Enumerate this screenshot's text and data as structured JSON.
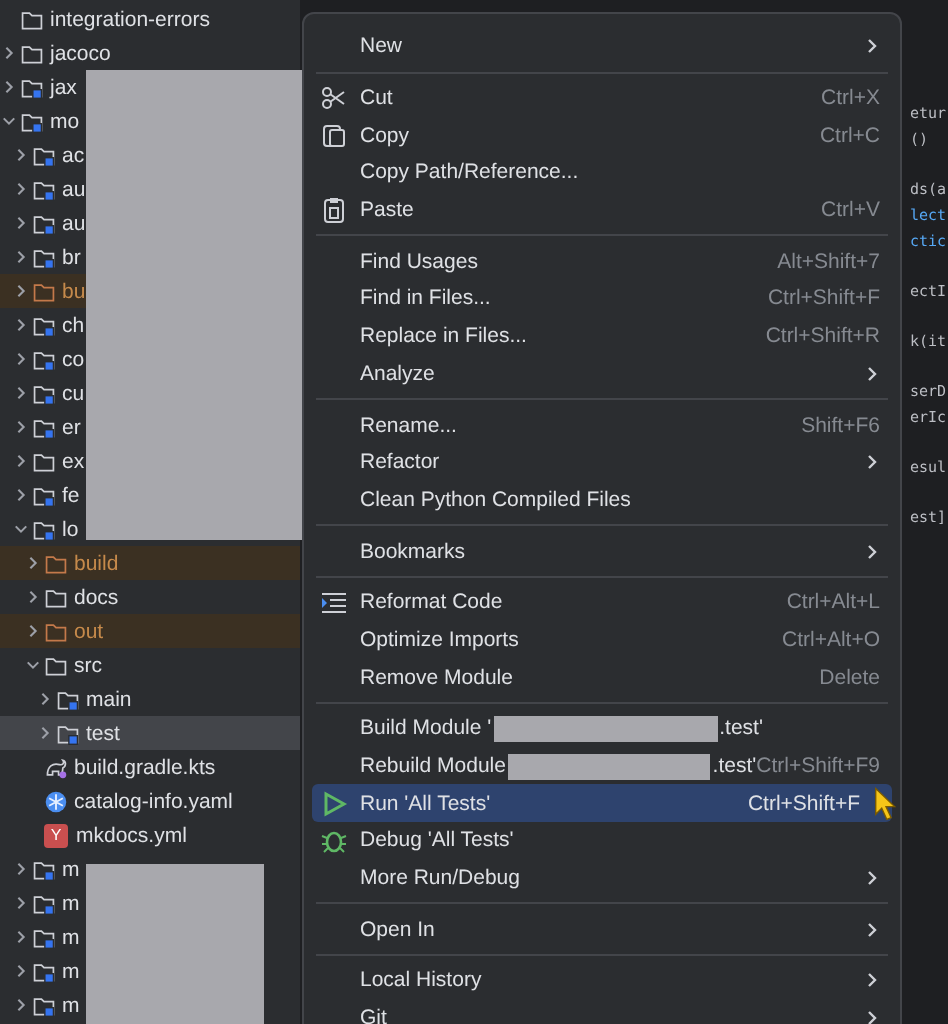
{
  "project_tree": [
    {
      "label": "integration-errors",
      "kind": "folder",
      "selected": false
    },
    {
      "label": "jacoco",
      "kind": "folder",
      "expanded": false,
      "selected": false
    },
    {
      "label": "jax",
      "kind": "module",
      "expanded": false,
      "selected": false
    },
    {
      "label": "mo",
      "kind": "module",
      "expanded": true,
      "selected": false,
      "children": [
        {
          "label": "ac",
          "kind": "module",
          "expanded": false,
          "selected": false
        },
        {
          "label": "au",
          "kind": "module",
          "expanded": false,
          "selected": false
        },
        {
          "label": "au",
          "kind": "module",
          "expanded": false,
          "selected": false
        },
        {
          "label": "br",
          "kind": "module",
          "expanded": false,
          "selected": false
        },
        {
          "label": "bu",
          "kind": "excluded",
          "expanded": false,
          "selected": false
        },
        {
          "label": "ch",
          "kind": "module",
          "expanded": false,
          "selected": false
        },
        {
          "label": "co",
          "kind": "module",
          "expanded": false,
          "selected": false
        },
        {
          "label": "cu",
          "kind": "module",
          "expanded": false,
          "selected": false
        },
        {
          "label": "er",
          "kind": "module",
          "expanded": false,
          "selected": false
        },
        {
          "label": "ex",
          "kind": "folder",
          "expanded": false,
          "selected": false
        },
        {
          "label": "fe",
          "kind": "module",
          "expanded": false,
          "selected": false
        },
        {
          "label": "lo",
          "kind": "module",
          "expanded": true,
          "selected": false,
          "children": [
            {
              "label": "build",
              "kind": "excluded",
              "expanded": false,
              "selected": false
            },
            {
              "label": "docs",
              "kind": "folder",
              "expanded": false,
              "selected": false
            },
            {
              "label": "out",
              "kind": "excluded",
              "expanded": false,
              "selected": false
            },
            {
              "label": "src",
              "kind": "folder",
              "expanded": true,
              "selected": false,
              "children": [
                {
                  "label": "main",
                  "kind": "source",
                  "expanded": false,
                  "selected": false
                },
                {
                  "label": "test",
                  "kind": "source",
                  "expanded": false,
                  "selected": true
                }
              ]
            },
            {
              "label": "build.gradle.kts",
              "kind": "gradle",
              "selected": false
            },
            {
              "label": "catalog-info.yaml",
              "kind": "catalog",
              "selected": false
            },
            {
              "label": "mkdocs.yml",
              "kind": "yaml",
              "icon_text": "Y",
              "selected": false
            }
          ]
        },
        {
          "label": "m",
          "kind": "module",
          "expanded": false,
          "selected": false
        },
        {
          "label": "m",
          "kind": "module",
          "expanded": false,
          "selected": false
        },
        {
          "label": "m",
          "kind": "module",
          "expanded": false,
          "selected": false
        },
        {
          "label": "m",
          "kind": "module",
          "expanded": false,
          "selected": false
        },
        {
          "label": "m",
          "kind": "module",
          "expanded": false,
          "selected": false
        }
      ]
    }
  ],
  "code_fragments": [
    [
      "etur",
      "()"
    ],
    [
      "ds(a",
      "lect",
      "ctic"
    ],
    [
      "ectI"
    ],
    [
      "k(it"
    ],
    [
      "serD",
      "erIc"
    ],
    [
      "esul"
    ],
    [
      "est]"
    ]
  ],
  "context_menu": [
    [
      {
        "label": "New",
        "submenu": true,
        "selected": false
      }
    ],
    [
      {
        "label": "Cut",
        "shortcut": "Ctrl+X",
        "kind": "scissors",
        "selected": false
      },
      {
        "label": "Copy",
        "shortcut": "Ctrl+C",
        "kind": "copy",
        "selected": false
      },
      {
        "label": "Copy Path/Reference...",
        "selected": false
      },
      {
        "label": "Paste",
        "shortcut": "Ctrl+V",
        "kind": "paste",
        "selected": false
      }
    ],
    [
      {
        "label": "Find Usages",
        "shortcut": "Alt+Shift+7",
        "selected": false
      },
      {
        "label": "Find in Files...",
        "shortcut": "Ctrl+Shift+F",
        "selected": false
      },
      {
        "label": "Replace in Files...",
        "shortcut": "Ctrl+Shift+R",
        "selected": false
      },
      {
        "label": "Analyze",
        "submenu": true,
        "selected": false
      }
    ],
    [
      {
        "label": "Rename...",
        "shortcut": "Shift+F6",
        "selected": false
      },
      {
        "label": "Refactor",
        "submenu": true,
        "selected": false
      },
      {
        "label": "Clean Python Compiled Files",
        "selected": false
      }
    ],
    [
      {
        "label": "Bookmarks",
        "submenu": true,
        "selected": false
      }
    ],
    [
      {
        "label": "Reformat Code",
        "shortcut": "Ctrl+Alt+L",
        "kind": "reformat",
        "selected": false
      },
      {
        "label": "Optimize Imports",
        "shortcut": "Ctrl+Alt+O",
        "selected": false
      },
      {
        "label": "Remove Module",
        "shortcut": "Delete",
        "selected": false
      }
    ],
    [
      {
        "label": "Build Module '",
        "label_end": ".test'",
        "redacted": true,
        "selected": false
      },
      {
        "label": "Rebuild Module",
        "label_end": ".test'",
        "redacted": true,
        "shortcut": "Ctrl+Shift+F9",
        "selected": false
      },
      {
        "label": "Run 'All Tests'",
        "shortcut": "Ctrl+Shift+F",
        "kind": "run",
        "selected": true
      },
      {
        "label": "Debug 'All Tests'",
        "kind": "debug",
        "selected": false
      },
      {
        "label": "More Run/Debug",
        "submenu": true,
        "selected": false
      }
    ],
    [
      {
        "label": "Open In",
        "submenu": true,
        "selected": false
      }
    ],
    [
      {
        "label": "Local History",
        "submenu": true,
        "selected": false
      },
      {
        "label": "Git",
        "submenu": true,
        "selected": false
      }
    ]
  ]
}
